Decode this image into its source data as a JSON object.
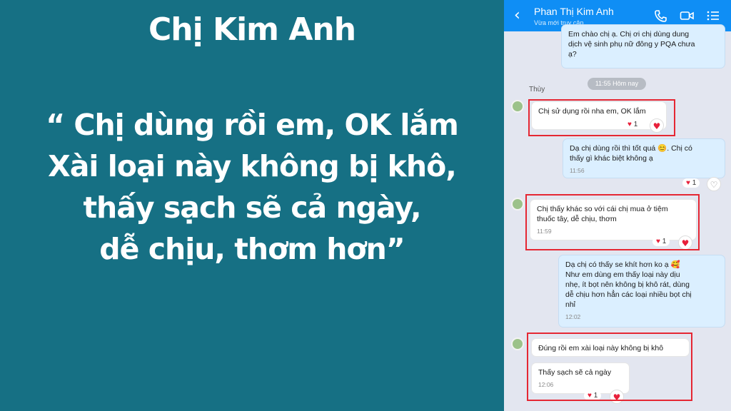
{
  "left": {
    "name": "Chị Kim Anh",
    "quote_lines": [
      "“ Chị dùng rồi em, OK lắm",
      "Xài loại này không bị khô,",
      "thấy sạch sẽ cả ngày,",
      "dễ chịu, thơm hơn”"
    ]
  },
  "chat": {
    "contact_name": "Phan Thị Kim Anh",
    "status": "Vừa mới truy cập",
    "icons": [
      "back-chevron-icon",
      "phone-icon",
      "video-icon",
      "menu-list-icon"
    ],
    "messages": {
      "m1": {
        "lines": [
          "Em chào chị ạ. Chị ơi chị dùng dung",
          "dịch vệ sinh phụ nữ đông y PQA chưa",
          "ạ?"
        ]
      },
      "time_pill": "11:55 Hôm nay",
      "sender": "Thùy",
      "m2": {
        "text": "Chị sử dụng rồi nha em, OK lắm",
        "reaction_count": "1"
      },
      "m3": {
        "lines": [
          "Dạ chị dùng rồi thì tốt quá 😊. Chị có",
          "thấy gì khác biệt không ạ"
        ],
        "time": "11:56",
        "reaction_count": "1"
      },
      "m4": {
        "lines": [
          "Chị thấy khác so với cái chị mua ở tiệm",
          "thuốc tây, dễ chịu, thơm"
        ],
        "time": "11:59",
        "reaction_count": "1"
      },
      "m5": {
        "lines": [
          "Dạ chị có thấy se khít hơn ko ạ 🥰",
          "Như em dùng em thấy loại này dịu",
          "nhẹ, ít bọt nên không bị khô rát, dùng",
          "dễ chịu hơn hẳn các loại nhiều bọt chị",
          "nhỉ"
        ],
        "time": "12:02"
      },
      "m6": {
        "text": "Đúng rồi em xài loại này không bị khô"
      },
      "m7": {
        "text": "Thấy sạch sẽ cả ngày",
        "time": "12:06",
        "reaction_count": "1"
      }
    },
    "colors": {
      "header": "#0f8ef5",
      "highlight": "#e52733",
      "heart": "#e8203a"
    }
  }
}
